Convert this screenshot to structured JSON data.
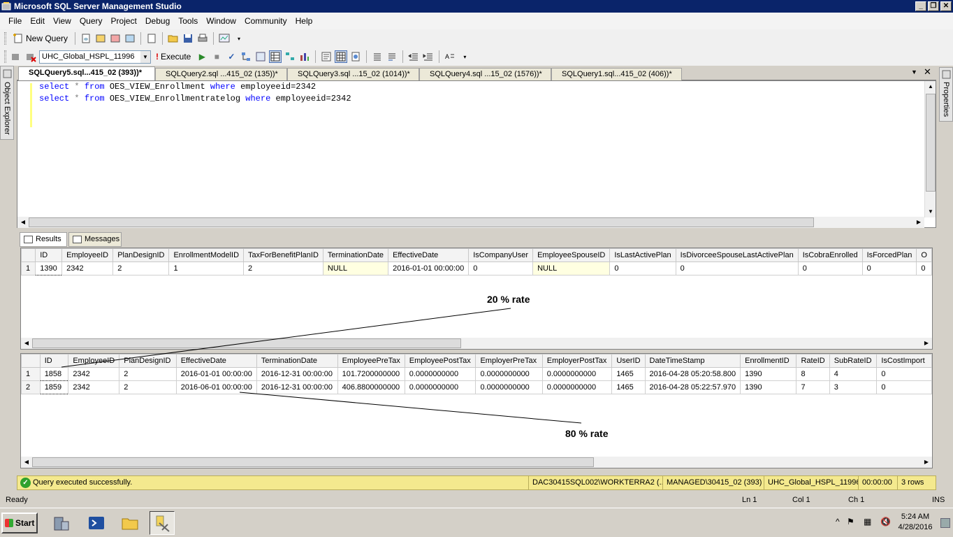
{
  "window": {
    "title": "Microsoft SQL Server Management Studio",
    "controls": [
      "_",
      "❐",
      "✕"
    ]
  },
  "menu": [
    "File",
    "Edit",
    "View",
    "Query",
    "Project",
    "Debug",
    "Tools",
    "Window",
    "Community",
    "Help"
  ],
  "toolbar1": {
    "new_query": "New Query"
  },
  "toolbar2": {
    "database": "UHC_Global_HSPL_11996",
    "execute": "Execute"
  },
  "side_panels": {
    "left": "Object Explorer",
    "right": "Properties"
  },
  "doc_tabs": [
    {
      "label": "SQLQuery5.sql...415_02 (393))*",
      "active": true
    },
    {
      "label": "SQLQuery2.sql ...415_02 (135))*",
      "active": false
    },
    {
      "label": "SQLQuery3.sql ...15_02 (1014))*",
      "active": false
    },
    {
      "label": "SQLQuery4.sql ...15_02 (1576))*",
      "active": false
    },
    {
      "label": "SQLQuery1.sql...415_02 (406))*",
      "active": false
    }
  ],
  "editor": {
    "lines": [
      {
        "kw1": "select",
        "op": " * ",
        "kw2": "from",
        "table": " OES_VIEW_Enrollment ",
        "kw3": "where",
        "cond": " employeeid=2342"
      },
      {
        "kw1": "select",
        "op": " * ",
        "kw2": "from",
        "table": " OES_VIEW_Enrollmentratelog ",
        "kw3": "where",
        "cond": " employeeid=2342"
      }
    ]
  },
  "result_tabs": {
    "results": "Results",
    "messages": "Messages"
  },
  "grid1": {
    "columns": [
      "ID",
      "EmployeeID",
      "PlanDesignID",
      "EnrollmentModelID",
      "TaxForBenefitPlanID",
      "TerminationDate",
      "EffectiveDate",
      "IsCompanyUser",
      "EmployeeSpouseID",
      "IsLastActivePlan",
      "IsDivorceeSpouseLastActivePlan",
      "IsCobraEnrolled",
      "IsForcedPlan",
      "O"
    ],
    "rows": [
      [
        "1",
        "1390",
        "2342",
        "2",
        "1",
        "2",
        "NULL",
        "2016-01-01 00:00:00",
        "0",
        "NULL",
        "0",
        "0",
        "0",
        "0",
        "0"
      ]
    ]
  },
  "grid2": {
    "columns": [
      "ID",
      "EmployeeID",
      "PlanDesignID",
      "EffectiveDate",
      "TerminationDate",
      "EmployeePreTax",
      "EmployeePostTax",
      "EmployerPreTax",
      "EmployerPostTax",
      "UserID",
      "DateTimeStamp",
      "EnrollmentID",
      "RateID",
      "SubRateID",
      "IsCostImport"
    ],
    "rows": [
      [
        "1",
        "1858",
        "2342",
        "2",
        "2016-01-01 00:00:00",
        "2016-12-31 00:00:00",
        "101.7200000000",
        "0.0000000000",
        "0.0000000000",
        "0.0000000000",
        "1465",
        "2016-04-28 05:20:58.800",
        "1390",
        "8",
        "4",
        "0"
      ],
      [
        "2",
        "1859",
        "2342",
        "2",
        "2016-06-01 00:00:00",
        "2016-12-31 00:00:00",
        "406.8800000000",
        "0.0000000000",
        "0.0000000000",
        "0.0000000000",
        "1465",
        "2016-04-28 05:22:57.970",
        "1390",
        "7",
        "3",
        "0"
      ]
    ]
  },
  "annotations": {
    "top": "20 % rate",
    "bottom": "80 % rate"
  },
  "query_status": {
    "message": "Query executed successfully.",
    "server": "DAC30415SQL002\\WORKTERRA2 (...",
    "user": "MANAGED\\30415_02 (393)",
    "database": "UHC_Global_HSPL_11996",
    "elapsed": "00:00:00",
    "rows": "3 rows"
  },
  "app_status": {
    "ready": "Ready",
    "ln": "Ln 1",
    "col": "Col 1",
    "ch": "Ch 1",
    "mode": "INS"
  },
  "taskbar": {
    "start": "Start",
    "time": "5:24 AM",
    "date": "4/28/2016"
  }
}
